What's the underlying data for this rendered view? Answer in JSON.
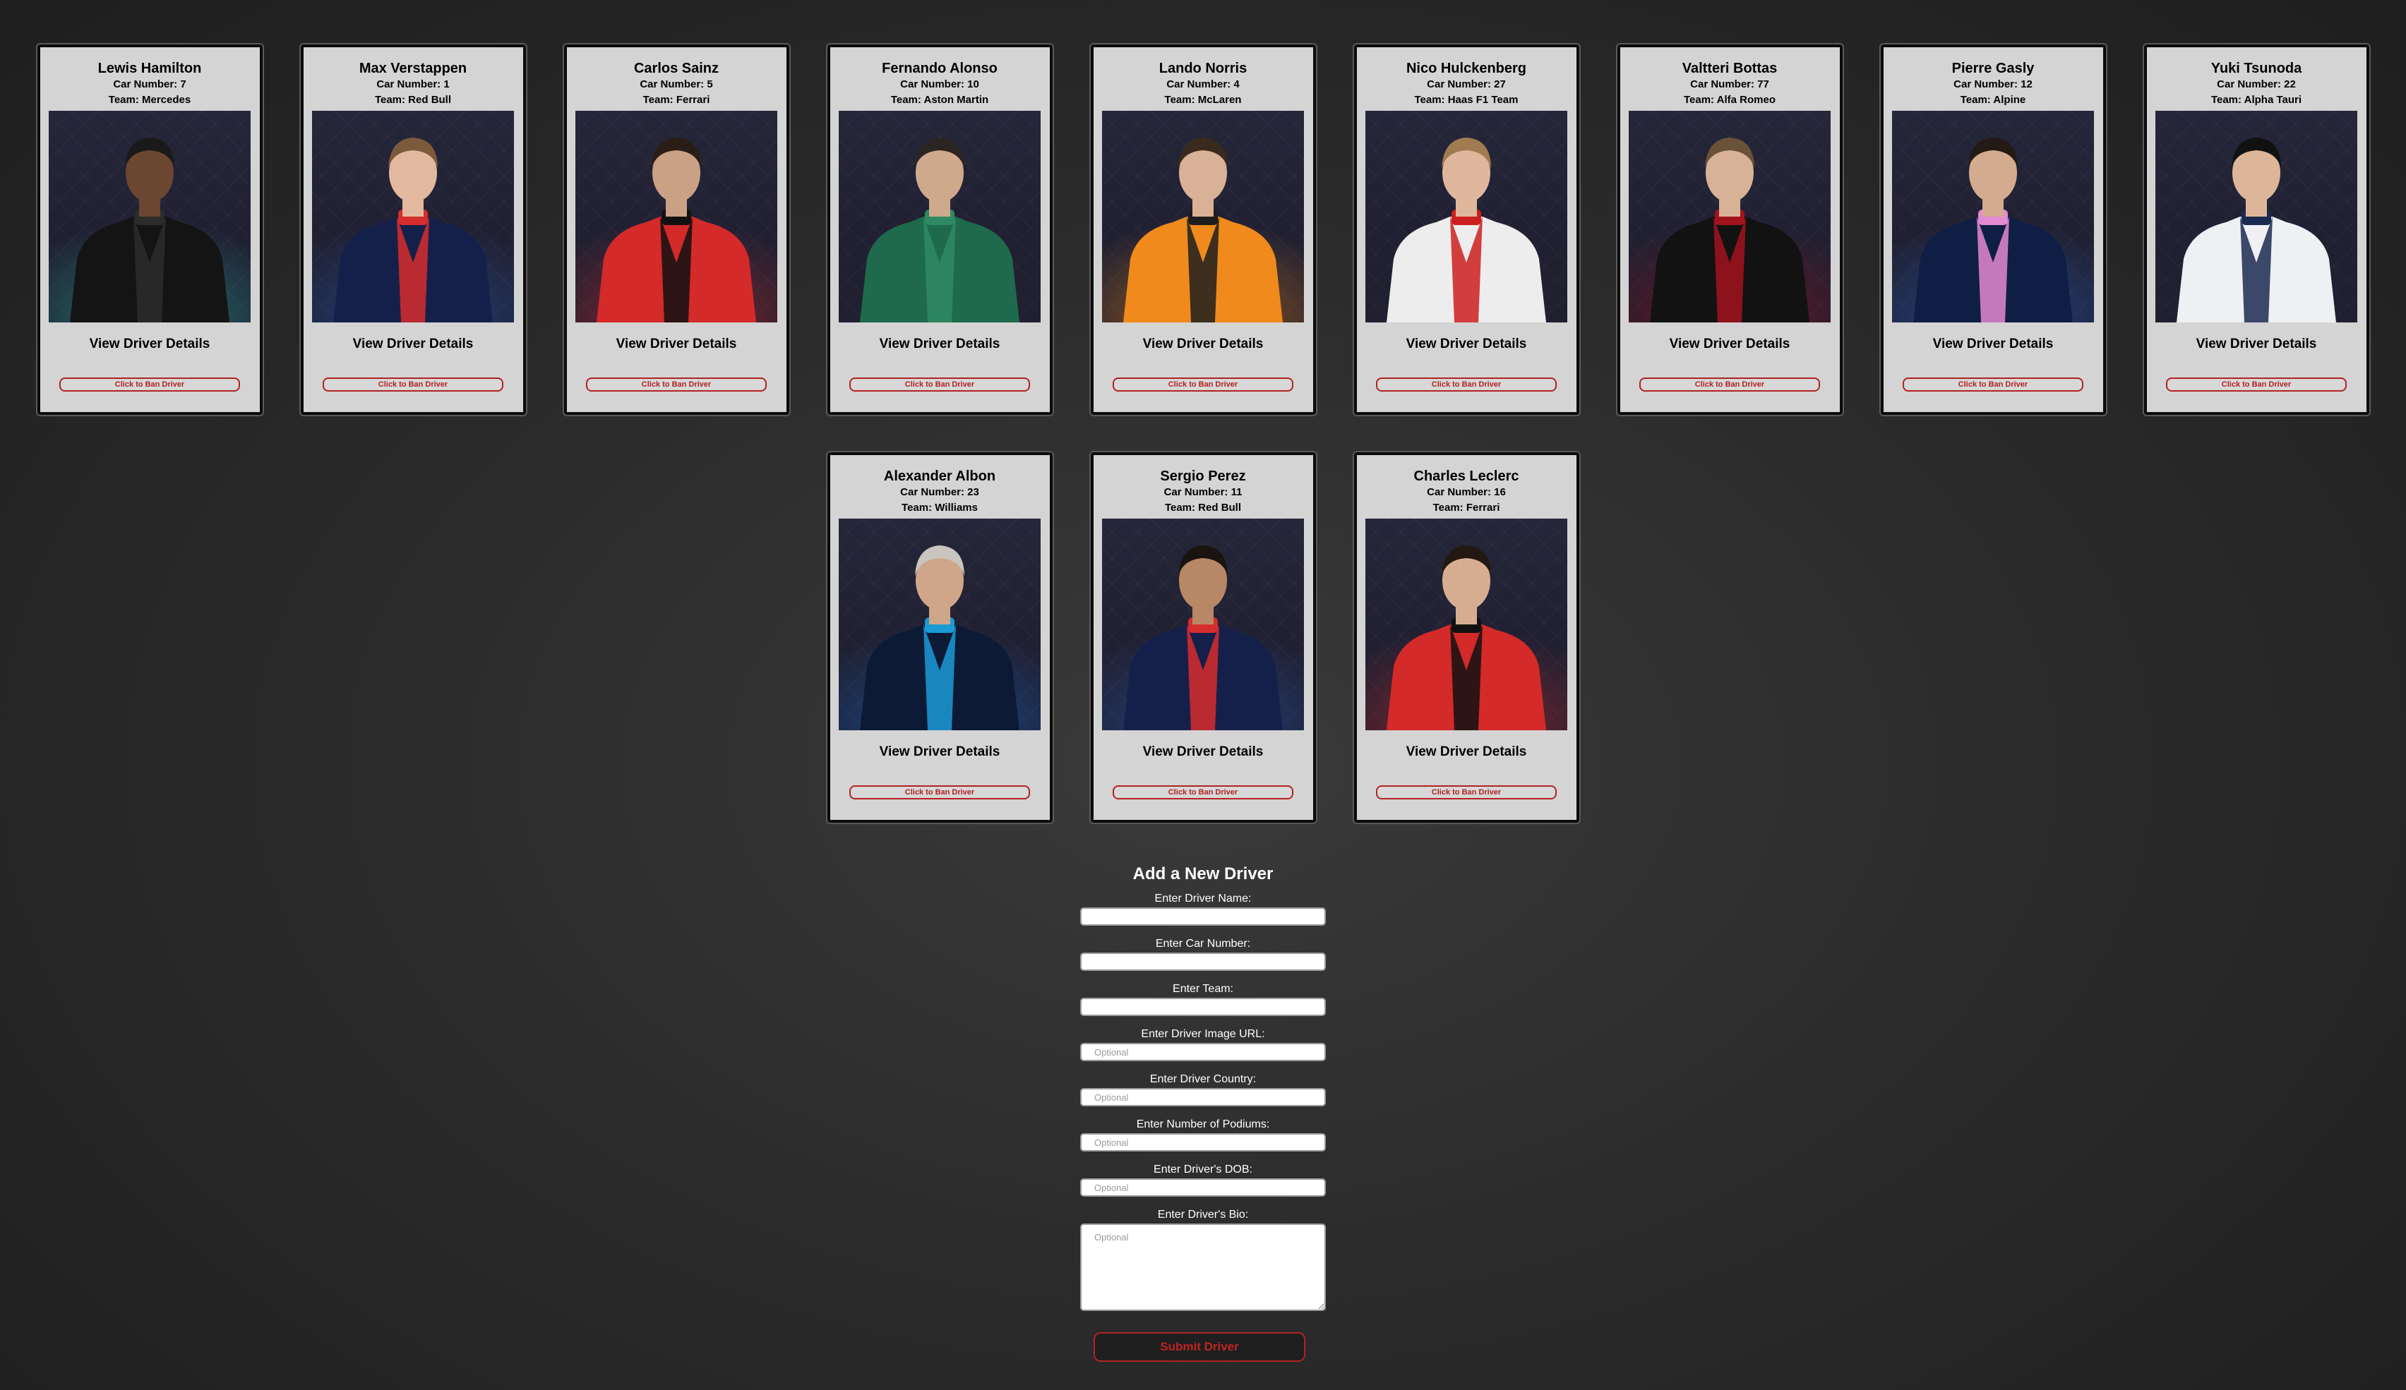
{
  "drivers": [
    {
      "name": "Lewis Hamilton",
      "car_number": "Car Number: 7",
      "team": "Team: Mercedes",
      "suit_primary": "#141414",
      "suit_accent": "#2c2c2c",
      "skin": "#6b4630",
      "hair": "#1a1a1a",
      "glow": "#2fb3a6"
    },
    {
      "name": "Max Verstappen",
      "car_number": "Car Number: 1",
      "team": "Team: Red Bull",
      "suit_primary": "#15204a",
      "suit_accent": "#d62d2d",
      "skin": "#e2b99f",
      "hair": "#7a5a3b",
      "glow": "#2f5fbf"
    },
    {
      "name": "Carlos Sainz",
      "car_number": "Car Number: 5",
      "team": "Team: Ferrari",
      "suit_primary": "#d42a2a",
      "suit_accent": "#111111",
      "skin": "#caa185",
      "hair": "#2a1d16",
      "glow": "#d63030"
    },
    {
      "name": "Fernando Alonso",
      "car_number": "Car Number: 10",
      "team": "Team: Aston Martin",
      "suit_primary": "#1f6a4c",
      "suit_accent": "#2f8a63",
      "skin": "#cfa98c",
      "hair": "#2a2422",
      "glow": "#2a2a3a"
    },
    {
      "name": "Lando Norris",
      "car_number": "Car Number: 4",
      "team": "Team: McLaren",
      "suit_primary": "#f08a1c",
      "suit_accent": "#1d1d1d",
      "skin": "#d8b196",
      "hair": "#3a2a1e",
      "glow": "#f08a1c"
    },
    {
      "name": "Nico Hulckenberg",
      "car_number": "Car Number: 27",
      "team": "Team: Haas F1 Team",
      "suit_primary": "#ededed",
      "suit_accent": "#cc1f1f",
      "skin": "#dfb79c",
      "hair": "#a07b4f",
      "glow": "#2a2a3a"
    },
    {
      "name": "Valtteri Bottas",
      "car_number": "Car Number: 77",
      "team": "Team: Alfa Romeo",
      "suit_primary": "#121212",
      "suit_accent": "#a3131e",
      "skin": "#d8b296",
      "hair": "#6a5238",
      "glow": "#a3131e"
    },
    {
      "name": "Pierre Gasly",
      "car_number": "Car Number: 12",
      "team": "Team: Alpine",
      "suit_primary": "#0f1e44",
      "suit_accent": "#e48ad1",
      "skin": "#d3ab8f",
      "hair": "#231a16",
      "glow": "#2e6ad6"
    },
    {
      "name": "Yuki Tsunoda",
      "car_number": "Car Number: 22",
      "team": "Team: Alpha Tauri",
      "suit_primary": "#eef0f4",
      "suit_accent": "#1b2a50",
      "skin": "#ddb69a",
      "hair": "#111111",
      "glow": "#2a2a3a"
    },
    {
      "name": "Alexander Albon",
      "car_number": "Car Number: 23",
      "team": "Team: Williams",
      "suit_primary": "#0c1a36",
      "suit_accent": "#1c9ad6",
      "skin": "#cfa689",
      "hair": "#c9c6c0",
      "glow": "#1c6fd6"
    },
    {
      "name": "Sergio Perez",
      "car_number": "Car Number: 11",
      "team": "Team: Red Bull",
      "suit_primary": "#15204a",
      "suit_accent": "#d62d2d",
      "skin": "#b88766",
      "hair": "#1a1410",
      "glow": "#2f5fbf"
    },
    {
      "name": "Charles Leclerc",
      "car_number": "Car Number: 16",
      "team": "Team: Ferrari",
      "suit_primary": "#d42a2a",
      "suit_accent": "#111111",
      "skin": "#d6ad91",
      "hair": "#231812",
      "glow": "#d63030"
    }
  ],
  "card_labels": {
    "view_details": "View Driver Details",
    "ban_button": "Click to Ban Driver"
  },
  "form": {
    "title": "Add a New Driver",
    "fields": [
      {
        "label": "Enter Driver Name:",
        "placeholder": ""
      },
      {
        "label": "Enter Car Number:",
        "placeholder": ""
      },
      {
        "label": "Enter Team:",
        "placeholder": ""
      },
      {
        "label": "Enter Driver Image URL:",
        "placeholder": "Optional"
      },
      {
        "label": "Enter Driver Country:",
        "placeholder": "Optional"
      },
      {
        "label": "Enter Number of Podiums:",
        "placeholder": "Optional"
      },
      {
        "label": "Enter Driver's DOB:",
        "placeholder": "Optional"
      }
    ],
    "bio_label": "Enter Driver's Bio:",
    "bio_placeholder": "Optional",
    "submit_label": "Submit Driver"
  }
}
